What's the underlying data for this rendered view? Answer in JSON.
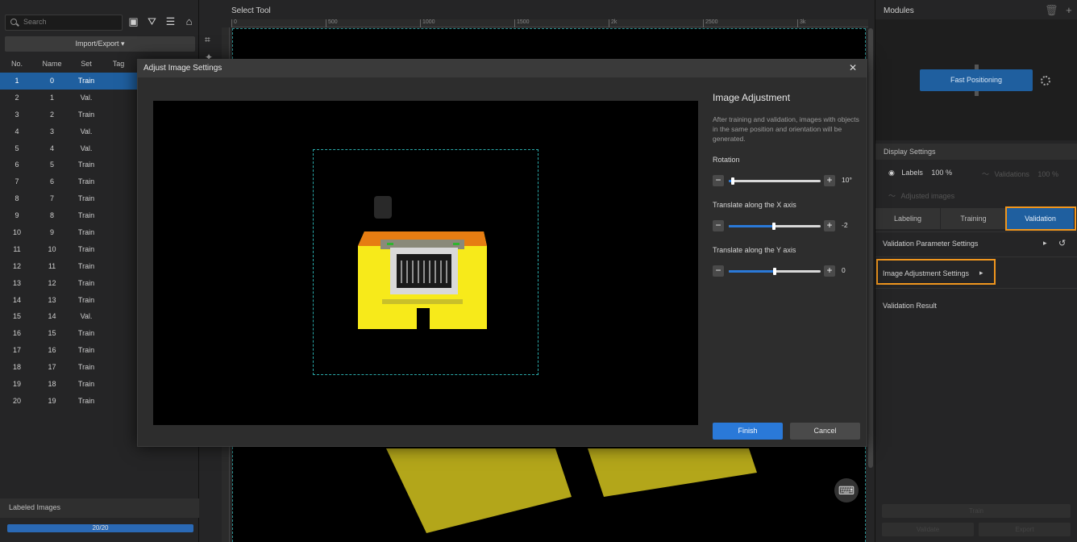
{
  "left_panel": {
    "search_placeholder": "Search",
    "import_export_label": "Import/Export ▾",
    "columns": [
      "No.",
      "Name",
      "Set",
      "Tag"
    ],
    "rows": [
      [
        "1",
        "0",
        "Train"
      ],
      [
        "2",
        "1",
        "Val."
      ],
      [
        "3",
        "2",
        "Train"
      ],
      [
        "4",
        "3",
        "Val."
      ],
      [
        "5",
        "4",
        "Val."
      ],
      [
        "6",
        "5",
        "Train"
      ],
      [
        "7",
        "6",
        "Train"
      ],
      [
        "8",
        "7",
        "Train"
      ],
      [
        "9",
        "8",
        "Train"
      ],
      [
        "10",
        "9",
        "Train"
      ],
      [
        "11",
        "10",
        "Train"
      ],
      [
        "12",
        "11",
        "Train"
      ],
      [
        "13",
        "12",
        "Train"
      ],
      [
        "14",
        "13",
        "Train"
      ],
      [
        "15",
        "14",
        "Val."
      ],
      [
        "16",
        "15",
        "Train"
      ],
      [
        "17",
        "16",
        "Train"
      ],
      [
        "18",
        "17",
        "Train"
      ],
      [
        "19",
        "18",
        "Train"
      ],
      [
        "20",
        "19",
        "Train"
      ]
    ],
    "selected_row": 0,
    "labeled_images_title": "Labeled Images",
    "progress_text": "20/20",
    "progress_fraction": 1.0
  },
  "middle": {
    "title": "Select Tool",
    "ruler_ticks": [
      "0",
      "500",
      "1000",
      "1500",
      "2k",
      "2500",
      "3k"
    ]
  },
  "right_panel": {
    "modules_title": "Modules",
    "module_name": "Fast Positioning",
    "display_settings_title": "Display Settings",
    "labels_text": "Labels",
    "labels_pct": "100 %",
    "validations_text": "Validations",
    "validations_pct": "100 %",
    "adjusted_images_text": "Adjusted images",
    "tabs": [
      "Labeling",
      "Training",
      "Validation"
    ],
    "active_tab": "Validation",
    "validation_param_settings": "Validation Parameter Settings",
    "image_adjustment_settings": "Image Adjustment Settings",
    "validation_result": "Validation Result",
    "bottom_btn_1": "Train",
    "bottom_btn_2": "Validate",
    "bottom_btn_3": "Export"
  },
  "modal": {
    "title": "Adjust Image Settings",
    "heading": "Image Adjustment",
    "description": "After training and validation, images with objects in the same position and orientation will be generated.",
    "sliders": [
      {
        "label": "Rotation",
        "value": "10°",
        "fraction": 0.04
      },
      {
        "label": "Translate along the X axis",
        "value": "-2",
        "fraction": 0.49
      },
      {
        "label": "Translate along the Y axis",
        "value": "0",
        "fraction": 0.5
      }
    ],
    "finish_label": "Finish",
    "cancel_label": "Cancel"
  },
  "colors": {
    "accent_blue": "#2a79d8",
    "highlight_orange": "#f0961e",
    "object_yellow": "#f3e60c"
  }
}
